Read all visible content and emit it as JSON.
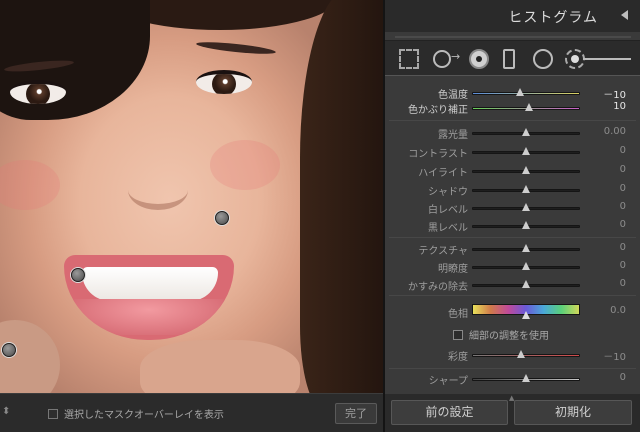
{
  "panel": {
    "title": "ヒストグラム",
    "sliders_group1": [
      {
        "label": "色温度",
        "value": "－10",
        "pos": 0.44,
        "track": "temp",
        "bright": true
      },
      {
        "label": "色かぶり補正",
        "value": "10",
        "pos": 0.53,
        "track": "tint",
        "bright": true
      }
    ],
    "sliders_group2": [
      {
        "label": "露光量",
        "value": "0.00",
        "pos": 0.5
      },
      {
        "label": "コントラスト",
        "value": "0",
        "pos": 0.5
      },
      {
        "label": "ハイライト",
        "value": "0",
        "pos": 0.5
      },
      {
        "label": "シャドウ",
        "value": "0",
        "pos": 0.5
      },
      {
        "label": "白レベル",
        "value": "0",
        "pos": 0.5
      },
      {
        "label": "黒レベル",
        "value": "0",
        "pos": 0.5
      }
    ],
    "sliders_group3": [
      {
        "label": "テクスチャ",
        "value": "0",
        "pos": 0.5
      },
      {
        "label": "明瞭度",
        "value": "0",
        "pos": 0.5
      },
      {
        "label": "かすみの除去",
        "value": "0",
        "pos": 0.5
      }
    ],
    "hue": {
      "label": "色相",
      "value": "0.0",
      "pos": 0.5
    },
    "fine_adjust": {
      "label": "細部の調整を使用",
      "checked": false
    },
    "saturation": {
      "label": "彩度",
      "value": "－10",
      "pos": 0.45
    },
    "sharpness": {
      "label": "シャープ",
      "value": "0",
      "pos": 0.5
    },
    "buttons": {
      "previous": "前の設定",
      "reset": "初期化"
    }
  },
  "toolbar": {
    "mask_overlay_label": "選択したマスクオーバーレイを表示",
    "mask_overlay_checked": false,
    "done_label": "完了"
  },
  "icons": {
    "collapse": "triangle-left-icon",
    "tools": [
      "crop-overlay-icon",
      "spot-removal-icon",
      "red-eye-icon",
      "graduated-filter-icon",
      "radial-filter-icon",
      "adjustment-brush-icon"
    ]
  },
  "colors": {
    "panel_bg": "#3a3a3a",
    "header_bg": "#2a2a2a",
    "photo_bg": "#1c1c1c"
  }
}
